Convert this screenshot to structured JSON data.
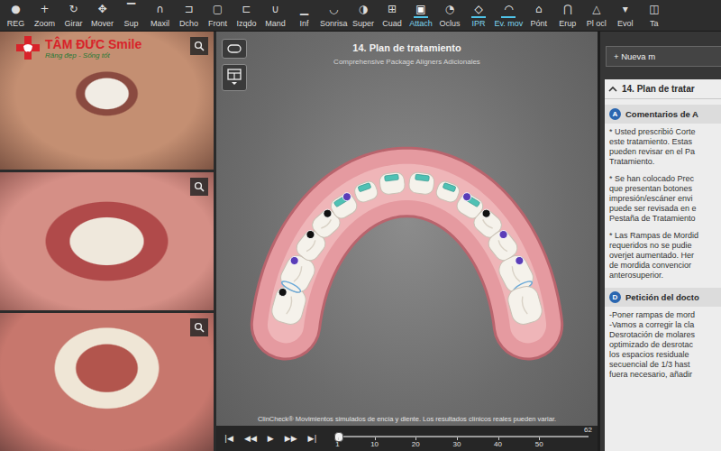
{
  "watermark": {
    "name": "TÂM ĐỨC Smile",
    "tagline": "Răng đẹp - Sống tốt"
  },
  "toolbar": [
    {
      "label": "REG",
      "icon": "●",
      "selected": false
    },
    {
      "label": "Zoom",
      "icon": "+",
      "selected": false
    },
    {
      "label": "Girar",
      "icon": "↻",
      "selected": false
    },
    {
      "label": "Mover",
      "icon": "✥",
      "selected": false
    },
    {
      "label": "Sup",
      "icon": "▔",
      "selected": false
    },
    {
      "label": "Maxil",
      "icon": "∩",
      "selected": false
    },
    {
      "label": "Dcho",
      "icon": "⊐",
      "selected": false
    },
    {
      "label": "Front",
      "icon": "▢",
      "selected": false
    },
    {
      "label": "Izqdo",
      "icon": "⊏",
      "selected": false
    },
    {
      "label": "Mand",
      "icon": "∪",
      "selected": false
    },
    {
      "label": "Inf",
      "icon": "▁",
      "selected": false
    },
    {
      "label": "Sonrisa",
      "icon": "◡",
      "selected": false
    },
    {
      "label": "Super",
      "icon": "◑",
      "selected": false
    },
    {
      "label": "Cuad",
      "icon": "⊞",
      "selected": false
    },
    {
      "label": "Attach",
      "icon": "▣",
      "selected": true
    },
    {
      "label": "Oclus",
      "icon": "◔",
      "selected": false
    },
    {
      "label": "IPR",
      "icon": "◇",
      "selected": true
    },
    {
      "label": "Ev. mov",
      "icon": "◠",
      "selected": true
    },
    {
      "label": "Pónt",
      "icon": "⌂",
      "selected": false
    },
    {
      "label": "Erup",
      "icon": "⋂",
      "selected": false
    },
    {
      "label": "Pl ocl",
      "icon": "△",
      "selected": false
    },
    {
      "label": "Evol",
      "icon": "▾",
      "selected": false
    },
    {
      "label": "Ta",
      "icon": "◫",
      "selected": false
    }
  ],
  "photos": [
    {
      "kind": "smile"
    },
    {
      "kind": "frontal"
    },
    {
      "kind": "occlusal"
    }
  ],
  "viewer": {
    "title": "14. Plan de tratamiento",
    "subtitle": "Comprehensive Package Aligners Adicionales",
    "teeth": [
      {
        "attachment": false,
        "marker": "#111111",
        "ipr": false
      },
      {
        "attachment": false,
        "marker": "#5a3db8",
        "ipr": true
      },
      {
        "attachment": false,
        "marker": "#111111",
        "ipr": false
      },
      {
        "attachment": false,
        "marker": "#111111",
        "ipr": false
      },
      {
        "attachment": true,
        "marker": "#5a3db8",
        "ipr": false
      },
      {
        "attachment": true,
        "marker": "",
        "ipr": false
      },
      {
        "attachment": true,
        "marker": "",
        "ipr": false
      },
      {
        "attachment": true,
        "marker": "",
        "ipr": false
      },
      {
        "attachment": true,
        "marker": "",
        "ipr": false
      },
      {
        "attachment": true,
        "marker": "#5a3db8",
        "ipr": false
      },
      {
        "attachment": false,
        "marker": "#111111",
        "ipr": false
      },
      {
        "attachment": false,
        "marker": "#5a3db8",
        "ipr": false
      },
      {
        "attachment": false,
        "marker": "#5a3db8",
        "ipr": true
      },
      {
        "attachment": false,
        "marker": "",
        "ipr": false
      }
    ],
    "disclaimer": "ClinCheck® Movimientos simulados de encía y diente. Los resultados clínicos reales pueden variar."
  },
  "timeline": {
    "controls": [
      "|◀",
      "◀◀",
      "▶",
      "▶▶",
      "▶|"
    ],
    "ticks": [
      "1",
      "10",
      "20",
      "30",
      "40",
      "50"
    ],
    "stage_count": "62",
    "level": 0
  },
  "side_panel": {
    "new_button": "+ Nueva m",
    "header": "14. Plan de tratar",
    "expanded": true,
    "sections": [
      {
        "badge": "A",
        "title": "Comentarios de A",
        "paragraphs": [
          [
            "* Usted prescribió Corte",
            "este tratamiento. Estas",
            "pueden revisar en el Pa",
            "Tratamiento."
          ],
          [
            "* Se han colocado Prec",
            "que presentan botones",
            "impresión/escáner envi",
            "puede ser revisada en e",
            "Pestaña de Tratamiento"
          ],
          [
            "* Las Rampas de Mordid",
            "requeridos no se pudie",
            "overjet aumentado. Her",
            "de mordida convencior",
            "anterosuperior."
          ]
        ]
      },
      {
        "badge": "D",
        "title": "Petición del docto",
        "paragraphs": [
          [
            "-Poner rampas de mord",
            "-Vamos a corregir la cla",
            "Desrotación de molares",
            "optimizado de desrotac",
            "los espacios residuale",
            "secuencial de 1/3 hast",
            "fuera necesario, añadir"
          ]
        ]
      }
    ]
  }
}
